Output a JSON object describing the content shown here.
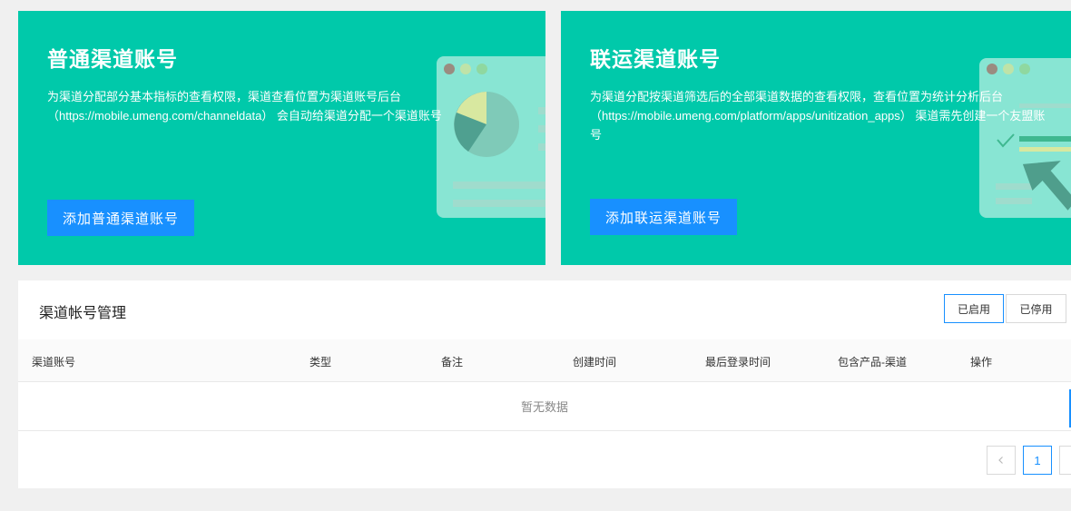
{
  "cards": [
    {
      "title": "普通渠道账号",
      "description": "为渠道分配部分基本指标的查看权限，渠道查看位置为渠道账号后台（https://mobile.umeng.com/channeldata） 会自动给渠道分配一个渠道账号",
      "button_label": "添加普通渠道账号",
      "illustration": "pie-chart-window-illustration"
    },
    {
      "title": "联运渠道账号",
      "description": "为渠道分配按渠道筛选后的全部渠道数据的查看权限，查看位置为统计分析后台（https://mobile.umeng.com/platform/apps/unitization_apps） 渠道需先创建一个友盟账号",
      "button_label": "添加联运渠道账号",
      "illustration": "checklist-cursor-illustration"
    }
  ],
  "panel": {
    "title": "渠道帐号管理",
    "toggle": {
      "enabled_label": "已启用",
      "disabled_label": "已停用",
      "active": "已启用"
    },
    "columns": [
      "渠道账号",
      "类型",
      "备注",
      "创建时间",
      "最后登录时间",
      "包含产品-渠道",
      "操作"
    ],
    "empty_text": "暂无数据",
    "pagination": {
      "prev_icon": "chevron-left-icon",
      "current_page": "1"
    }
  },
  "colors": {
    "card_bg": "#00c9aa",
    "primary": "#1890ff",
    "page_bg": "#f0f0f0"
  }
}
